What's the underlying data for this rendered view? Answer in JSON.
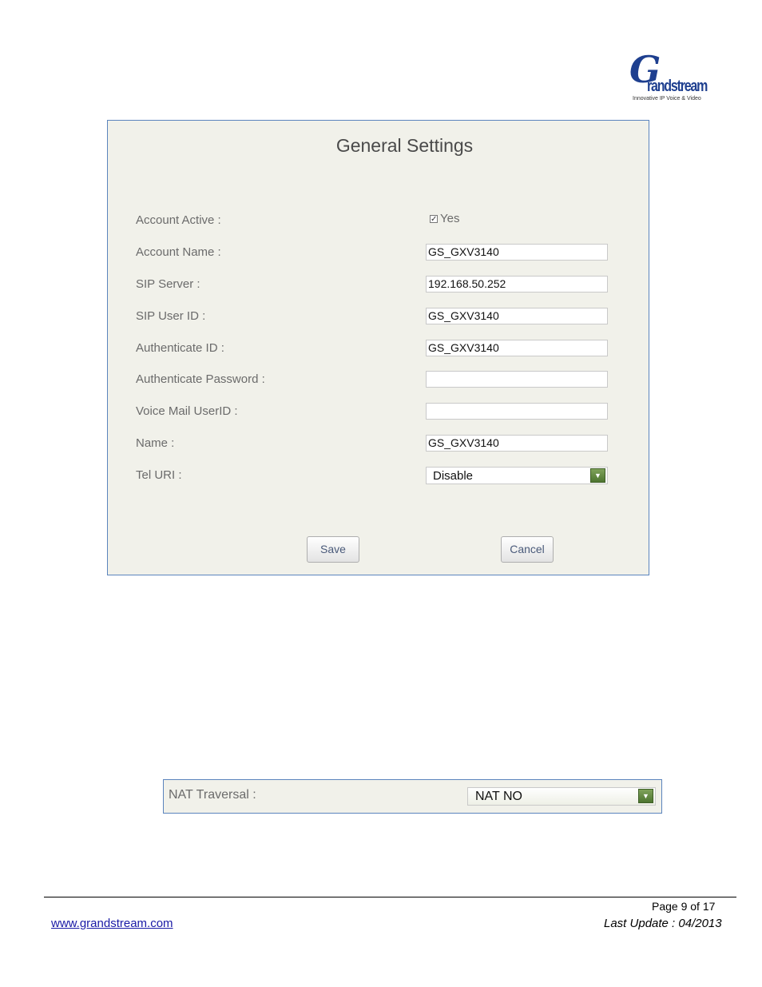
{
  "logo": {
    "mark": "G",
    "word": "randstream",
    "tagline": "Innovative IP Voice & Video"
  },
  "general_settings": {
    "title": "General Settings",
    "fields": {
      "account_active": {
        "label": "Account Active :",
        "checked": true,
        "check_label": "Yes"
      },
      "account_name": {
        "label": "Account Name :",
        "value": "GS_GXV3140"
      },
      "sip_server": {
        "label": "SIP Server :",
        "value": "192.168.50.252"
      },
      "sip_user_id": {
        "label": "SIP User ID :",
        "value": "GS_GXV3140"
      },
      "authenticate_id": {
        "label": "Authenticate ID :",
        "value": "GS_GXV3140"
      },
      "authenticate_password": {
        "label": "Authenticate Password :",
        "value": ""
      },
      "voice_mail_userid": {
        "label": "Voice Mail UserID :",
        "value": ""
      },
      "name": {
        "label": "Name :",
        "value": "GS_GXV3140"
      },
      "tel_uri": {
        "label": "Tel URI :",
        "value": "Disable"
      }
    },
    "save_label": "Save",
    "cancel_label": "Cancel"
  },
  "nat": {
    "label": "NAT Traversal :",
    "value": "NAT NO"
  },
  "footer": {
    "page": "Page 9 of 17",
    "website": "www.grandstream.com",
    "last_update": "Last Update : 04/2013"
  },
  "colors": {
    "panel_bg": "#f1f1ea",
    "panel_border": "#5b84bd",
    "dropdown_button": "#5e8a3c",
    "brand_blue": "#1e3f8f"
  },
  "icons": {
    "checkbox": "checkbox-checked-icon",
    "dropdown": "triangle-down-icon"
  }
}
